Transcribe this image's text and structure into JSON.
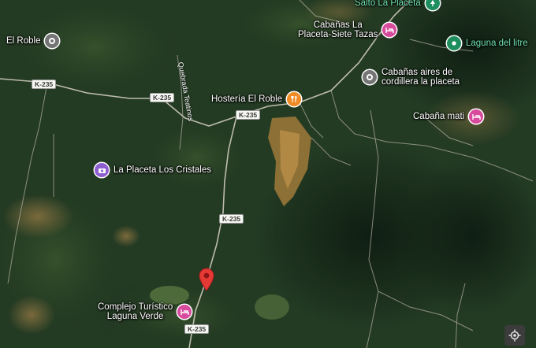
{
  "map": {
    "type": "satellite",
    "colors": {
      "poi_grey": "#757575",
      "poi_green": "#1e8e5e",
      "poi_pink": "#d84a9c",
      "poi_purple": "#8e5fd0",
      "poi_orange": "#f08a24",
      "marker_red": "#e53935"
    },
    "pois": [
      {
        "name": "Salto La Placeta",
        "icon": "park-icon"
      },
      {
        "name": "El Roble",
        "icon": "location-icon"
      },
      {
        "name": "Cabañas La\nPlaceta-Siete Tazas",
        "icon": "hotel-icon"
      },
      {
        "name": "Laguna del litre",
        "icon": "park-icon"
      },
      {
        "name": "Cabañas aires de\ncordillera la placeta",
        "icon": "location-icon"
      },
      {
        "name": "Hostería El Roble",
        "icon": "restaurant-icon"
      },
      {
        "name": "Cabaña mati",
        "icon": "hotel-icon"
      },
      {
        "name": "La Placeta Los Cristales",
        "icon": "camera-icon"
      },
      {
        "name": "Complejo Turístico\nLaguna Verde",
        "icon": "hotel-icon"
      }
    ],
    "road_labels": [
      "K-235",
      "K-235",
      "K-235",
      "K-235",
      "K-235"
    ],
    "street_labels": [
      "Quebrada Teatinos"
    ],
    "controls": {
      "location_button": "my-location-icon"
    }
  }
}
